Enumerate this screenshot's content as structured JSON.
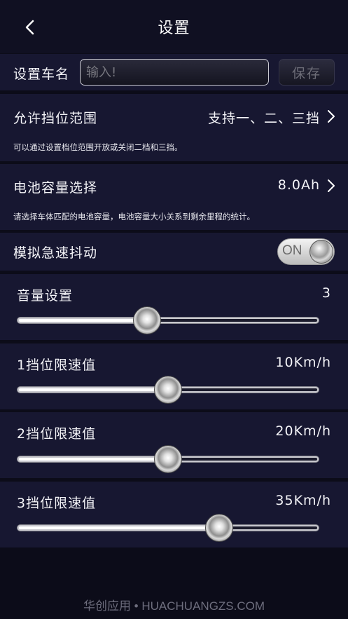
{
  "header": {
    "title": "设置"
  },
  "car_name": {
    "label": "设置车名",
    "placeholder": "输入!",
    "save_label": "保存"
  },
  "gear_range": {
    "label": "允许挡位范围",
    "value": "支持一、二、三挡",
    "hint": "可以通过设置档位范围开放或关闭二档和三挡。"
  },
  "battery": {
    "label": "电池容量选择",
    "value": "8.0Ah",
    "hint": "请选择车体匹配的电池容量，电池容量大小关系到剩余里程的统计。"
  },
  "jitter": {
    "label": "模拟急速抖动",
    "toggle_label": "ON",
    "enabled": true
  },
  "sliders": [
    {
      "label": "音量设置",
      "value": "3",
      "fraction": 0.43
    },
    {
      "label": "1挡位限速值",
      "value": "10Km/h",
      "fraction": 0.5
    },
    {
      "label": "2挡位限速值",
      "value": "20Km/h",
      "fraction": 0.5
    },
    {
      "label": "3挡位限速值",
      "value": "35Km/h",
      "fraction": 0.67
    }
  ],
  "footer": {
    "text": "华创应用 • HUACHUANGZS.COM"
  },
  "icons": {
    "back": "chevron-left-icon",
    "row_arrow": "chevron-right-icon"
  },
  "colors": {
    "background": "#0c0c19",
    "section": "#171731",
    "text": "#f4f4f8"
  }
}
